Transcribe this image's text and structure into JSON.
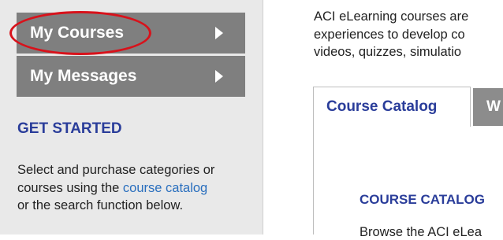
{
  "sidebar": {
    "nav": [
      {
        "label": "My Courses"
      },
      {
        "label": "My Messages"
      }
    ],
    "get_started_heading": "GET STARTED",
    "intro": {
      "before_link": "Select and purchase categories or courses using the ",
      "link_text": "course catalog",
      "after_link": " or the search function below."
    }
  },
  "main": {
    "lead_lines": [
      "ACI eLearning courses are",
      "experiences to develop co",
      "videos, quizzes, simulatio"
    ],
    "tabs": [
      {
        "label": "Course Catalog",
        "active": true
      },
      {
        "label": "W",
        "active": false
      }
    ],
    "panel": {
      "title": "COURSE CATALOG",
      "text": "Browse the ACI eLea"
    }
  },
  "colors": {
    "nav_bg": "#7f7f7f",
    "sidebar_bg": "#e9e9e9",
    "heading_blue": "#2a3d9a",
    "link_blue": "#2a6fbe",
    "annotation_red": "#d8121b"
  }
}
